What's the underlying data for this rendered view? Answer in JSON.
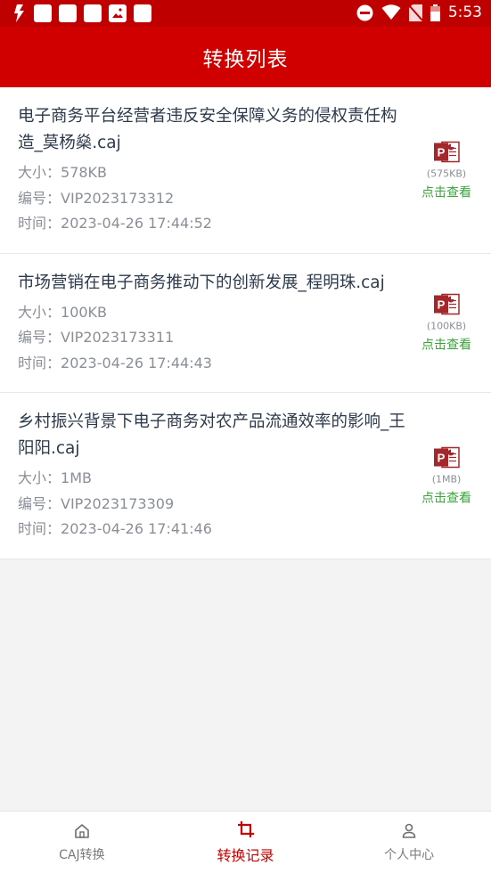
{
  "status_bar": {
    "time": "5:53",
    "icons": [
      "flash-icon",
      "notification-square-icon",
      "notification-square-icon",
      "notification-square-icon",
      "image-icon",
      "notification-square-icon",
      "do-not-disturb-icon",
      "wifi-icon",
      "no-sim-icon",
      "battery-icon"
    ]
  },
  "header": {
    "title": "转换列表"
  },
  "colors": {
    "status_bar": "#bf0000",
    "app_bar": "#d10000",
    "accent_green": "#3aa43a",
    "active_tab": "#c70000"
  },
  "items": [
    {
      "title": "电子商务平台经营者违反安全保障义务的侵权责任构造_莫杨燊.caj",
      "size_key": "大小：",
      "size": "578KB",
      "id_key": "编号：",
      "id": "VIP2023173312",
      "time_key": "时间：",
      "time": "2023-04-26 17:44:52",
      "file_size_badge": "(575KB)",
      "view_label": "点击查看"
    },
    {
      "title": "市场营销在电子商务推动下的创新发展_程明珠.caj",
      "size_key": "大小：",
      "size": "100KB",
      "id_key": "编号：",
      "id": "VIP2023173311",
      "time_key": "时间：",
      "time": "2023-04-26 17:44:43",
      "file_size_badge": "(100KB)",
      "view_label": "点击查看"
    },
    {
      "title": "乡村振兴背景下电子商务对农产品流通效率的影响_王阳阳.caj",
      "size_key": "大小：",
      "size": "1MB",
      "id_key": "编号：",
      "id": "VIP2023173309",
      "time_key": "时间：",
      "time": "2023-04-26 17:41:46",
      "file_size_badge": "(1MB)",
      "view_label": "点击查看"
    }
  ],
  "tabs": [
    {
      "label": "CAJ转换",
      "icon": "home-icon",
      "active": false
    },
    {
      "label": "转换记录",
      "icon": "crop-icon",
      "active": true
    },
    {
      "label": "个人中心",
      "icon": "person-icon",
      "active": false
    }
  ]
}
